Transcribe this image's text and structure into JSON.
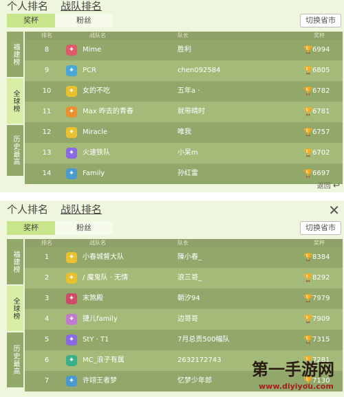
{
  "panel1": {
    "title_personal": "个人排名",
    "title_team": "战队排名",
    "tab_tab1": "奖杯",
    "tab_tab2": "粉丝",
    "switch_label": "切换省市",
    "side": [
      "福建榜",
      "全球榜",
      "历史最高"
    ],
    "side_active_index": 1,
    "headers": [
      "排名",
      "战队名",
      "队长",
      "奖杯"
    ],
    "rows": [
      {
        "rank": "8",
        "name": "Mime",
        "captain": "胜利",
        "score": "6994",
        "icon_color": "#e05a6a"
      },
      {
        "rank": "9",
        "name": "PCR",
        "captain": "chen092584",
        "score": "6805",
        "icon_color": "#4aa8d8"
      },
      {
        "rank": "10",
        "name": "女的不吃",
        "captain": "五年a ·",
        "score": "6782",
        "icon_color": "#e8c030"
      },
      {
        "rank": "11",
        "name": "Max 昨去的青春",
        "captain": "就带晴时",
        "score": "6781",
        "icon_color": "#e89030"
      },
      {
        "rank": "12",
        "name": "Miracle",
        "captain": "唯我",
        "score": "6757",
        "icon_color": "#e8c030"
      },
      {
        "rank": "13",
        "name": "火速铁队",
        "captain": "小呆m",
        "score": "6702",
        "icon_color": "#8a6ae0"
      },
      {
        "rank": "14",
        "name": "Family",
        "captain": "孙红雷",
        "score": "6697",
        "icon_color": "#4a9ad0"
      }
    ],
    "footer": "返回"
  },
  "panel2": {
    "title_personal": "个人排名",
    "title_team": "战队排名",
    "tab_tab1": "奖杯",
    "tab_tab2": "粉丝",
    "switch_label": "切换省市",
    "side": [
      "福建榜",
      "全球榜",
      "历史最高"
    ],
    "side_active_index": 1,
    "headers": [
      "排名",
      "战队名",
      "队长",
      "奖杯"
    ],
    "rows": [
      {
        "rank": "1",
        "name": "小春城督大队",
        "captain": "陳小春_",
        "score": "8384",
        "icon_color": "#e8c030"
      },
      {
        "rank": "2",
        "name": "/ 魔鬼队 · 无情",
        "captain": "浪三哥_",
        "score": "8292",
        "icon_color": "#e8c030"
      },
      {
        "rank": "3",
        "name": "末煞殿",
        "captain": "朝汐94",
        "score": "7979",
        "icon_color": "#d04a6a"
      },
      {
        "rank": "4",
        "name": "捷儿family",
        "captain": "边哥哥",
        "score": "7909",
        "icon_color": "#c07ad0"
      },
      {
        "rank": "5",
        "name": "StY · T1",
        "captain": "7月总贡500幅队",
        "score": "7315",
        "icon_color": "#8a6ae0"
      },
      {
        "rank": "6",
        "name": "MC_浪子有属",
        "captain": "2632172743",
        "score": "7281",
        "icon_color": "#3ab08a"
      },
      {
        "rank": "7",
        "name": "许翊王者梦",
        "captain": "忆梦少年郎",
        "score": "7130",
        "icon_color": "#4a9ad0"
      }
    ]
  },
  "watermark": {
    "brand": "第一手游网",
    "url": "www.diyiyou.com"
  },
  "icons": {
    "trophy": "trophy-icon",
    "close": "close-icon",
    "back": "back-arrow-icon",
    "team_badge": "team-badge-icon"
  }
}
